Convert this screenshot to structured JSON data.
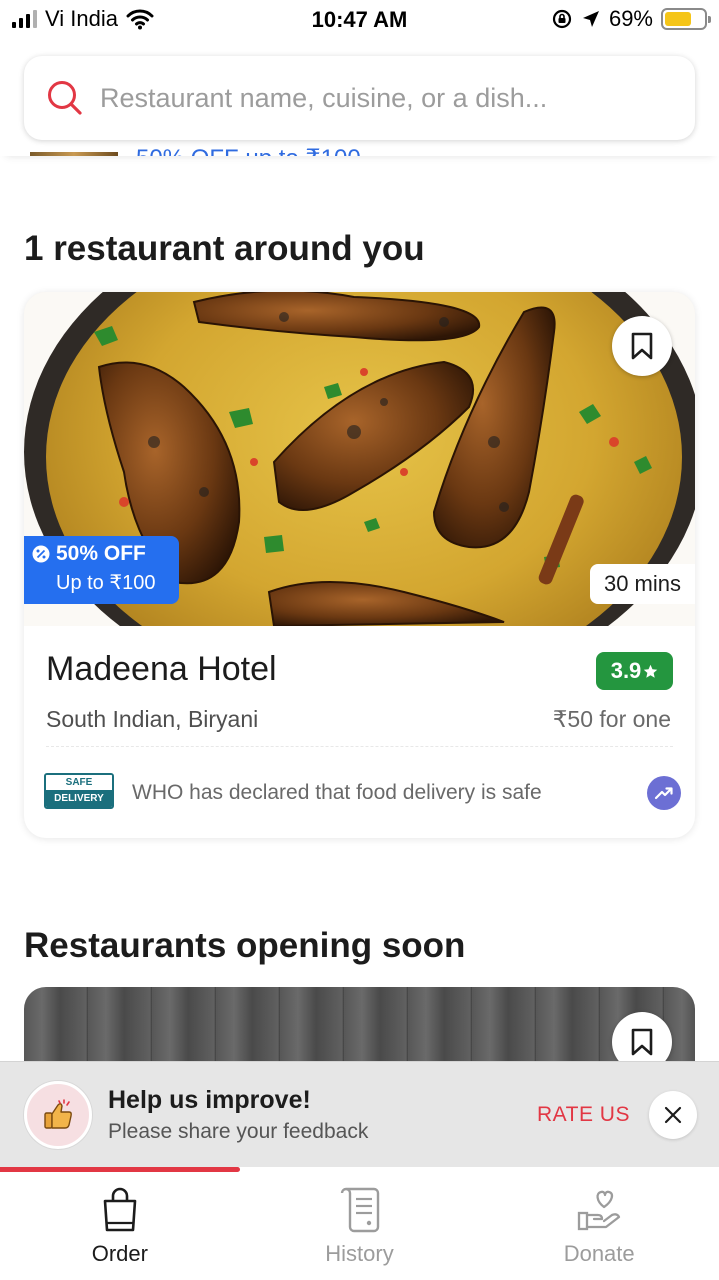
{
  "status_bar": {
    "carrier": "Vi India",
    "time": "10:47 AM",
    "battery": "69%",
    "icons": [
      "signal-icon",
      "wifi-icon",
      "rotation-lock-icon",
      "location-arrow-icon",
      "battery-icon"
    ]
  },
  "search": {
    "placeholder": "Restaurant name, cuisine, or a dish..."
  },
  "offer_peek": {
    "text": "50% OFF up to ₹100"
  },
  "section_nearby": {
    "title": "1 restaurant around you"
  },
  "restaurant": {
    "name": "Madeena Hotel",
    "rating": "3.9",
    "cuisine": "South Indian, Biryani",
    "price": "₹50 for one",
    "delivery_time": "30 mins",
    "offer_title": "50% OFF",
    "offer_subtitle": "Up to ₹100",
    "safe_badge_top": "SAFE",
    "safe_badge_bottom": "DELIVERY",
    "safety_note": "WHO has declared that food delivery is safe",
    "accent_color": "#256fef",
    "rating_color": "#24963f"
  },
  "section_soon": {
    "title": "Restaurants opening soon"
  },
  "feedback": {
    "title": "Help us improve!",
    "subtitle": "Please share your feedback",
    "action": "RATE US"
  },
  "bottom_nav": {
    "items": [
      {
        "label": "Order",
        "icon": "shopping-bag-icon",
        "active": true
      },
      {
        "label": "History",
        "icon": "receipt-icon",
        "active": false
      },
      {
        "label": "Donate",
        "icon": "heart-hand-icon",
        "active": false
      }
    ]
  },
  "brand_color": "#e23744"
}
